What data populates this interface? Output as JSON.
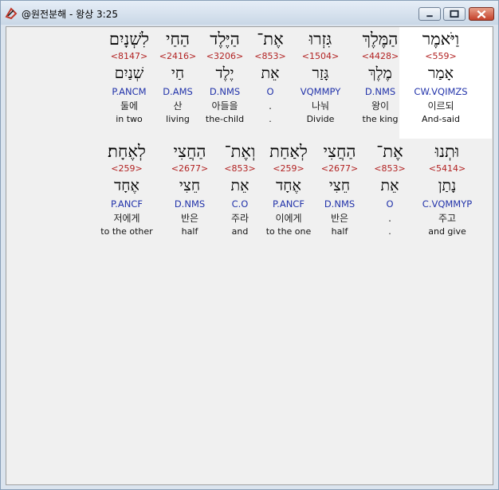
{
  "window": {
    "title": "@원전분해 - 왕상 3:25"
  },
  "rows": [
    [
      {
        "hebrew": "וַיֹּאמֶר",
        "strong": "<559>",
        "root": "אָמַר",
        "parse": "CW.VQIMZS",
        "korean": "이르되",
        "english": "And-said",
        "highlighted": true
      },
      {
        "hebrew": "הַמֶּלֶךְ",
        "strong": "<4428>",
        "root": "מֶלֶךְ",
        "parse": "D.NMS",
        "korean": "왕이",
        "english": "the king"
      },
      {
        "hebrew": "גִּזְרוּ",
        "strong": "<1504>",
        "root": "גָּזַר",
        "parse": "VQMMPY",
        "korean": "나눠",
        "english": "Divide"
      },
      {
        "hebrew": "אֶת־",
        "strong": "<853>",
        "root": "אֵת",
        "parse": "O",
        "korean": ".",
        "english": "."
      },
      {
        "hebrew": "הַיֶּלֶד",
        "strong": "<3206>",
        "root": "יֶלֶד",
        "parse": "D.NMS",
        "korean": "아들을",
        "english": "the-child"
      },
      {
        "hebrew": "הַחַי",
        "strong": "<2416>",
        "root": "חַי",
        "parse": "D.AMS",
        "korean": "산",
        "english": "living"
      },
      {
        "hebrew": "לִשְׁנָיִם",
        "strong": "<8147>",
        "root": "שְׁנַיִם",
        "parse": "P.ANCM",
        "korean": "둘에",
        "english": "in two"
      }
    ],
    [
      {
        "hebrew": "וּתְנוּ",
        "strong": "<5414>",
        "root": "נָתַן",
        "parse": "C.VQMMYP",
        "korean": "주고",
        "english": "and give"
      },
      {
        "hebrew": "אֶת־",
        "strong": "<853>",
        "root": "אֵת",
        "parse": "O",
        "korean": ".",
        "english": "."
      },
      {
        "hebrew": "הַחֲצִי",
        "strong": "<2677>",
        "root": "חֵצִי",
        "parse": "D.NMS",
        "korean": "반은",
        "english": "half"
      },
      {
        "hebrew": "לְאַחַת",
        "strong": "<259>",
        "root": "אֶחָד",
        "parse": "P.ANCF",
        "korean": "이에게",
        "english": "to the one"
      },
      {
        "hebrew": "וְאֶת־",
        "strong": "<853>",
        "root": "אֵת",
        "parse": "C.O",
        "korean": "주라",
        "english": "and"
      },
      {
        "hebrew": "הַחֲצִי",
        "strong": "<2677>",
        "root": "חֵצִי",
        "parse": "D.NMS",
        "korean": "반은",
        "english": "half"
      },
      {
        "hebrew": "לְאֶחָת׃",
        "strong": "<259>",
        "root": "אֶחָד",
        "parse": "P.ANCF",
        "korean": "저에게",
        "english": "to the other"
      }
    ]
  ]
}
